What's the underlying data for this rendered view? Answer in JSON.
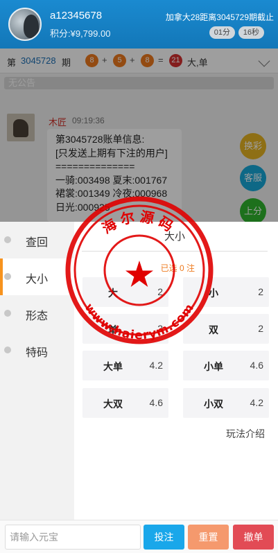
{
  "header": {
    "username": "a12345678",
    "points": "积分:¥9,799.00",
    "countdown_text": "加拿大28距离3045729期截止",
    "timer_minutes": "01分",
    "timer_seconds": "16秒"
  },
  "result_bar": {
    "prefix": "第",
    "period": "3045728",
    "suffix": "期",
    "ball1": "8",
    "ball2": "5",
    "ball3": "8",
    "sum": "21",
    "plus": "+",
    "equals": "=",
    "result": "大,单"
  },
  "notice": "无公告",
  "chat": {
    "name": "木匠",
    "time": "09:19:36",
    "lines": [
      "第3045728账单信息:",
      "[只发送上期有下注的用户]",
      "==============",
      "一骑:003498 夏末:001767",
      "裙裳:001349 冷夜:000968",
      "日光:000925"
    ]
  },
  "side_buttons": {
    "exchange": "换彩",
    "service": "客服",
    "topup": "上分"
  },
  "nav": {
    "items": [
      "查回",
      "大小",
      "形态",
      "特码"
    ],
    "active": 1
  },
  "panel": {
    "tab_title": "大小",
    "selected_text": "已选 0 注",
    "options": [
      {
        "name": "大",
        "odds": "2"
      },
      {
        "name": "小",
        "odds": "2"
      },
      {
        "name": "单",
        "odds": "2"
      },
      {
        "name": "双",
        "odds": "2"
      },
      {
        "name": "大单",
        "odds": "4.2"
      },
      {
        "name": "小单",
        "odds": "4.6"
      },
      {
        "name": "大双",
        "odds": "4.6"
      },
      {
        "name": "小双",
        "odds": "4.2"
      }
    ],
    "rules_link": "玩法介绍"
  },
  "bottom_bar": {
    "amount_placeholder": "请输入元宝",
    "bet_label": "投注",
    "reset_label": "重置",
    "undo_label": "撤单"
  },
  "watermark": {
    "top_text": "海尔源码",
    "bottom_text": "www.haierym.com"
  },
  "colors": {
    "header": "#1a8ad0",
    "accent": "#f7931e",
    "stamp": "#e00000"
  },
  "icons": [
    "user-avatar",
    "chevron-down-icon",
    "star-icon"
  ]
}
